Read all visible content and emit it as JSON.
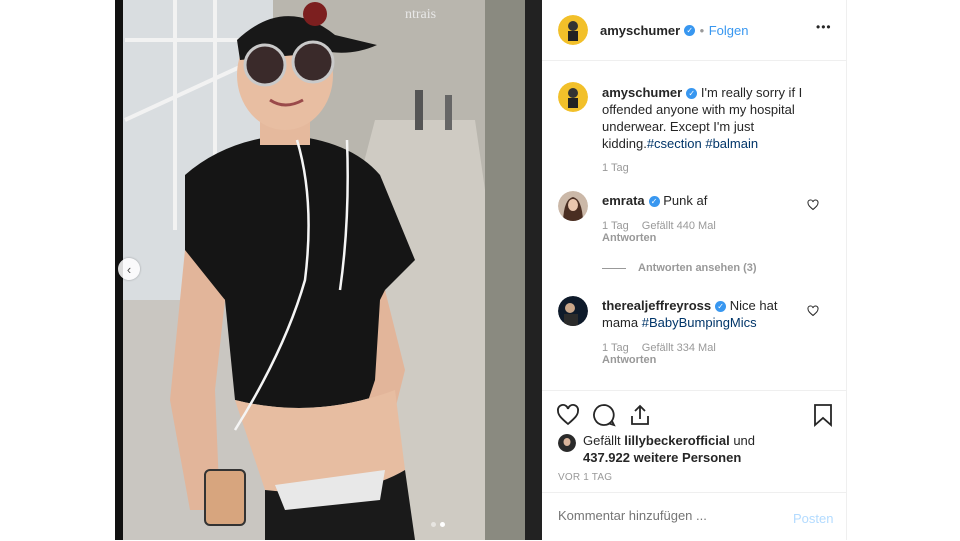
{
  "post": {
    "username": "amyschumer",
    "follow_label": "Folgen",
    "more_label": "•••",
    "caption_text": "I'm really sorry if I offended anyone with my hospital underwear. Except I'm just kidding.",
    "caption_hashtags": "#csection #balmain",
    "caption_time": "1 Tag"
  },
  "comments": [
    {
      "username": "emrata",
      "text": "Punk af",
      "time": "1 Tag",
      "likes": "Gefällt 440 Mal",
      "reply": "Antworten",
      "view_replies": "Antworten ansehen (3)"
    },
    {
      "username": "therealjeffreyross",
      "text": "Nice hat mama",
      "hashtag": "#BabyBumpingMics",
      "time": "1 Tag",
      "likes": "Gefällt 334 Mal",
      "reply": "Antworten"
    }
  ],
  "likes": {
    "prefix": "Gefällt",
    "user": "lillybeckerofficial",
    "and": "und",
    "count": "437.922 weitere Personen"
  },
  "timestamp": "VOR 1 TAG",
  "comment_input": {
    "placeholder": "Kommentar hinzufügen ...",
    "post_label": "Posten"
  },
  "nav": {
    "prev_label": "‹"
  },
  "colors": {
    "accent": "#3897f0",
    "link": "#003569",
    "muted": "#999999"
  }
}
